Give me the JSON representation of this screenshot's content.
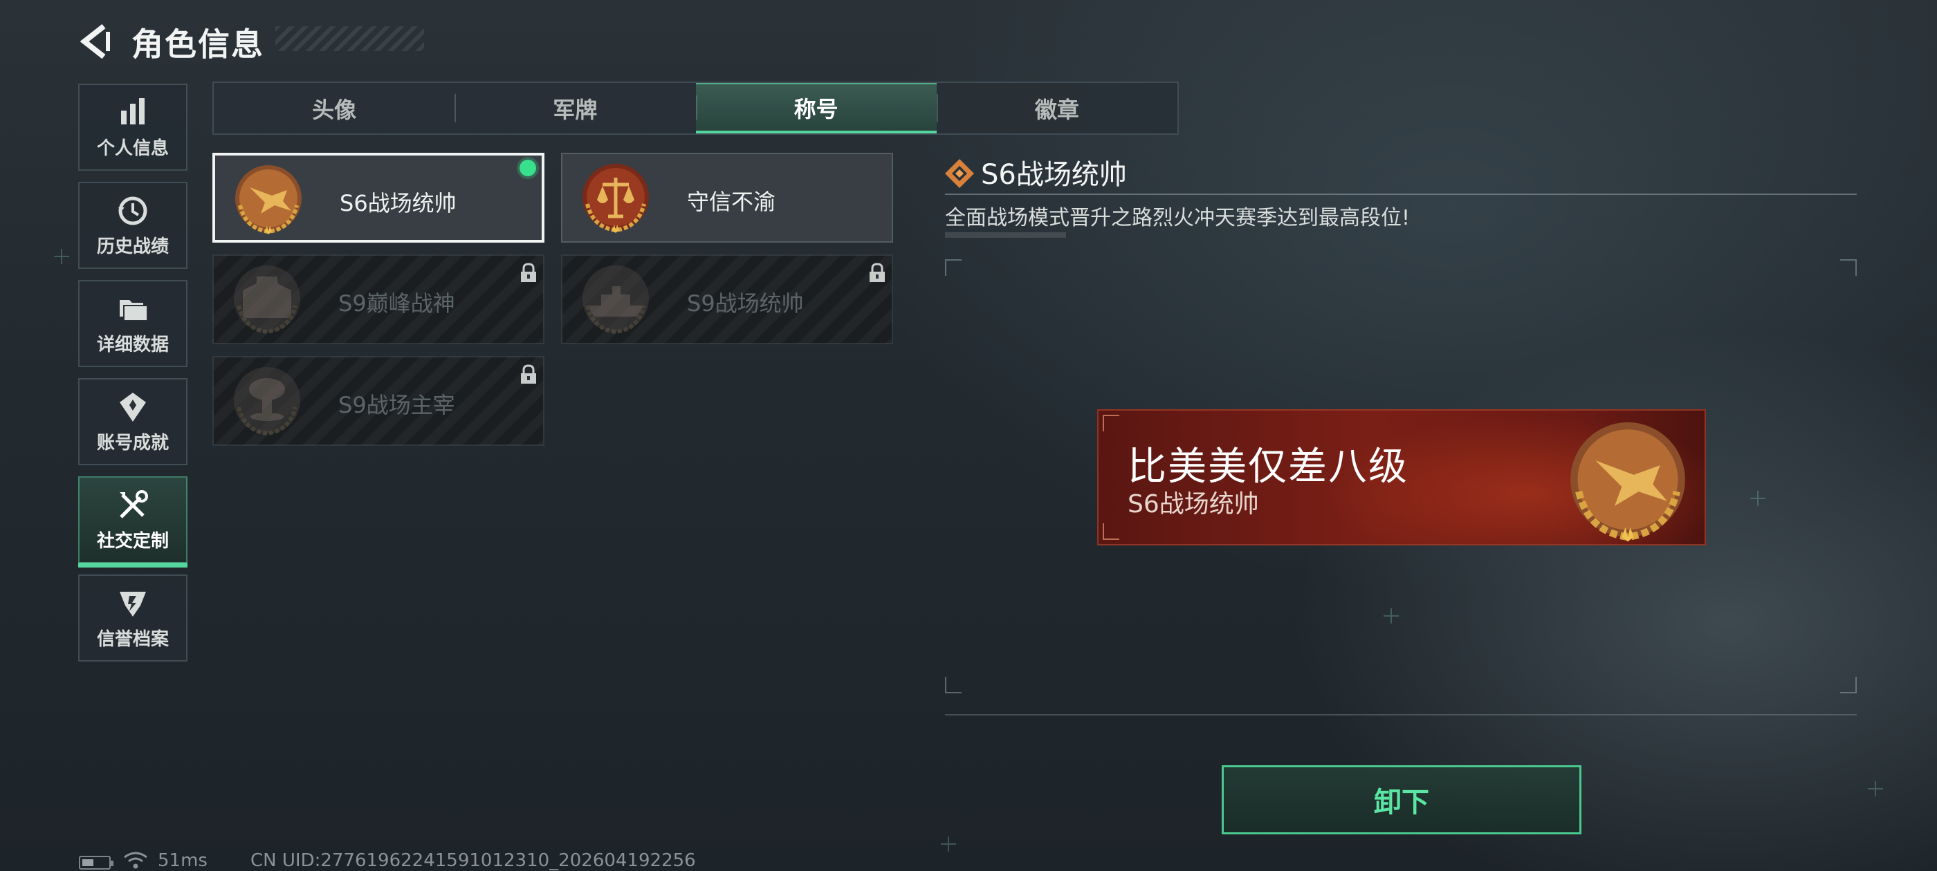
{
  "header": {
    "title": "角色信息"
  },
  "sidebar": {
    "items": [
      {
        "label": "个人信息",
        "icon": "bar-chart-icon"
      },
      {
        "label": "历史战绩",
        "icon": "history-clock-icon"
      },
      {
        "label": "详细数据",
        "icon": "folder-icon"
      },
      {
        "label": "账号成就",
        "icon": "achievement-icon"
      },
      {
        "label": "社交定制",
        "icon": "tools-icon",
        "active": true
      },
      {
        "label": "信誉档案",
        "icon": "credit-shield-icon"
      }
    ]
  },
  "tabs": [
    {
      "label": "头像"
    },
    {
      "label": "军牌"
    },
    {
      "label": "称号",
      "active": true
    },
    {
      "label": "徽章"
    }
  ],
  "titles": [
    {
      "name": "S6战场统帅",
      "locked": false,
      "selected": true,
      "equipped": true,
      "medal": "fighter-jet-medal"
    },
    {
      "name": "守信不渝",
      "locked": false,
      "selected": false,
      "equipped": false,
      "medal": "scales-medal"
    },
    {
      "name": "S9巅峰战神",
      "locked": true,
      "medal": "fortress-medal"
    },
    {
      "name": "S9战场统帅",
      "locked": true,
      "medal": "warship-medal"
    },
    {
      "name": "S9战场主宰",
      "locked": true,
      "medal": "mushroom-cloud-medal"
    }
  ],
  "detail": {
    "title": "S6战场统帅",
    "description": "全面战场模式晋升之路烈火冲天赛季达到最高段位!"
  },
  "preview": {
    "player_name": "比美美仅差八级",
    "title": "S6战场统帅"
  },
  "actions": {
    "unequip_label": "卸下"
  },
  "status": {
    "ping": "51ms",
    "uid": "CN UID:277619622415910123​10_202604192256"
  },
  "colors": {
    "accent": "#54d69d",
    "button_text": "#5be6a3",
    "banner_red": "#7a1f16",
    "gold": "#d9a441"
  }
}
